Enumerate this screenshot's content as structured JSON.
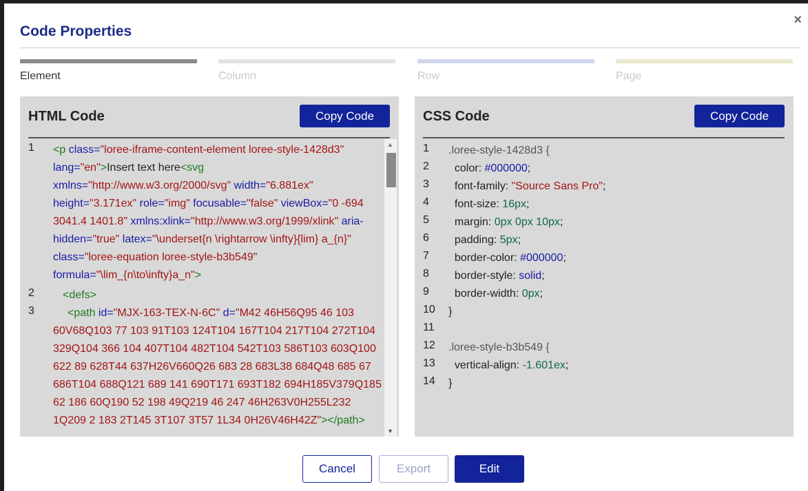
{
  "dialog": {
    "title": "Code Properties",
    "close_glyph": "×"
  },
  "steps": [
    {
      "label": "Element",
      "active": true,
      "bar_color": "#8c8c8c",
      "label_color": "#333333"
    },
    {
      "label": "Column",
      "active": false,
      "bar_color": "#e3e3e3",
      "label_color": "#c9c9c9"
    },
    {
      "label": "Row",
      "active": false,
      "bar_color": "#d2d6ee",
      "label_color": "#c9c9c9"
    },
    {
      "label": "Page",
      "active": false,
      "bar_color": "#ebe7cf",
      "label_color": "#c9c9c9"
    }
  ],
  "html_panel": {
    "heading": "HTML Code",
    "copy_label": "Copy Code",
    "line_numbers": [
      "1",
      "2",
      "3"
    ],
    "line1": {
      "t_open": "<p",
      "a_class": " class=",
      "v_class": "\"loree-iframe-content-element  loree-style-1428d3\"",
      "a_lang": " lang=",
      "v_lang": "\"en\"",
      "t_close": ">",
      "text": "Insert text here",
      "t_svg": "<svg",
      "a_xmlns": " xmlns=",
      "v_xmlns": "\"http://www.w3.org/2000/svg\"",
      "a_width": " width=",
      "v_width": "\"6.881ex\"",
      "a_height": " height=",
      "v_height": "\"3.171ex\"",
      "a_role": " role=",
      "v_role": "\"img\"",
      "a_focus": " focusable=",
      "v_focus": "\"false\"",
      "a_viewbox": " viewBox=",
      "v_viewbox": "\"0 -694 3041.4 1401.8\"",
      "a_xlink": " xmlns:xlink=",
      "v_xlink": "\"http://www.w3.org/1999/xlink\"",
      "a_aria": " aria-hidden=",
      "v_aria": "\"true\"",
      "a_latex": " latex=",
      "v_latex": "\"\\underset{n \\rightarrow \\infty}{lim} a_{n}\"",
      "a_class2": " class=",
      "v_class2": "\"loree-equation loree-style-b3b549\"",
      "a_formula": " formula=",
      "v_formula": "\"\\lim_{n\\to\\infty}a_n\"",
      "t_end": ">"
    },
    "line2": "<defs>",
    "line3": {
      "t_open": "<path",
      "a_id": " id=",
      "v_id": "\"MJX-163-TEX-N-6C\"",
      "a_d": " d=",
      "v_d": "\"M42 46H56Q95 46 103 60V68Q103 77 103 91T103 124T104 167T104 217T104 272T104 329Q104 366 104 407T104 482T104 542T103 586T103 603Q100 622 89 628T44 637H26V660Q26 683 28 683L38 684Q48 685 67 686T104 688Q121 689 141 690T171 693T182 694H185V379Q185 62 186 60Q190 52 198 49Q219 46 247 46H263V0H255L232 1Q209 2 183 2T145 3T107 3T57 1L34 0H26V46H42Z\"",
      "t_close": "></path>"
    }
  },
  "css_panel": {
    "heading": "CSS Code",
    "copy_label": "Copy Code",
    "lines": [
      {
        "num": "1",
        "sel": ".loree-style-1428d3 {"
      },
      {
        "num": "2",
        "prop": "  color",
        "val": "#000000",
        "vtype": "k"
      },
      {
        "num": "3",
        "prop": "  font-family",
        "val": "\"Source Sans Pro\"",
        "vtype": "v"
      },
      {
        "num": "4",
        "prop": "  font-size",
        "val": "16px",
        "vtype": "n"
      },
      {
        "num": "5",
        "prop": "  margin",
        "val": "0px 0px 10px",
        "vtype": "n"
      },
      {
        "num": "6",
        "prop": "  padding",
        "val": "5px",
        "vtype": "n"
      },
      {
        "num": "7",
        "prop": "  border-color",
        "val": "#000000",
        "vtype": "k"
      },
      {
        "num": "8",
        "prop": "  border-style",
        "val": "solid",
        "vtype": "k"
      },
      {
        "num": "9",
        "prop": "  border-width",
        "val": "0px",
        "vtype": "n"
      },
      {
        "num": "10",
        "sel": "}"
      },
      {
        "num": "11",
        "sel": ""
      },
      {
        "num": "12",
        "sel": ".loree-style-b3b549 {"
      },
      {
        "num": "13",
        "prop": "  vertical-align",
        "val": "-1.601ex",
        "vtype": "n"
      },
      {
        "num": "14",
        "sel": "}"
      }
    ]
  },
  "footer": {
    "cancel_label": "Cancel",
    "export_label": "Export",
    "edit_label": "Edit"
  },
  "colors": {
    "primary": "#13239a",
    "title": "#1b2c86",
    "panel_bg": "#d9d9d9"
  }
}
